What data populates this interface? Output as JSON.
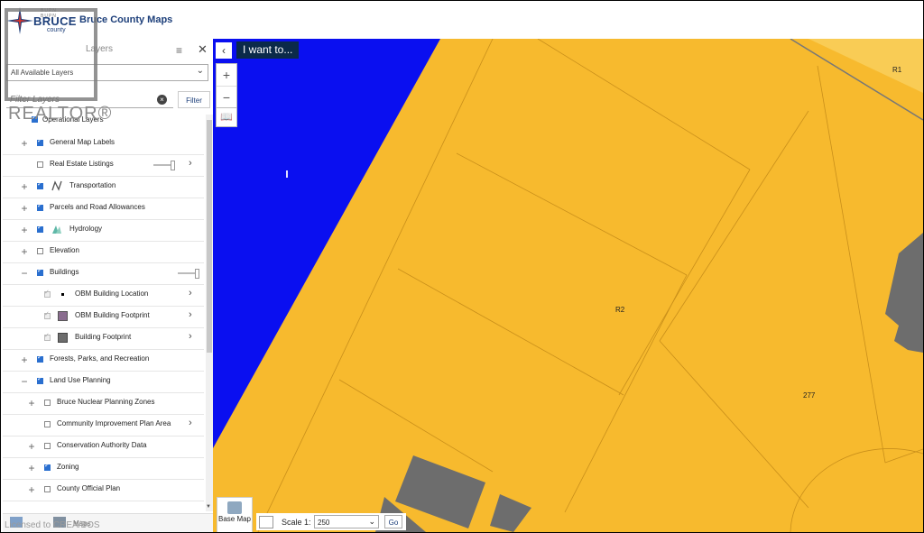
{
  "header": {
    "app_title": "Bruce County Maps",
    "logo_word": "BRUCE",
    "logo_sub": "county",
    "logo_tiny": "BUPN BUPN"
  },
  "panel": {
    "title": "Layers",
    "select_value": "All Available Layers",
    "filter_placeholder": "Filter Layers",
    "filter_button": "Filter",
    "root_label": "Operational Layers",
    "layers": [
      {
        "label": "General Map Labels",
        "checked": true,
        "expand": true
      },
      {
        "label": "Real Estate Listings",
        "checked": false
      },
      {
        "label": "Transportation",
        "checked": true,
        "expand": true
      },
      {
        "label": "Parcels and Road Allowances",
        "checked": true,
        "expand": true
      },
      {
        "label": "Hydrology",
        "checked": true,
        "expand": true
      },
      {
        "label": "Elevation",
        "checked": false,
        "expand": true
      },
      {
        "label": "Buildings",
        "checked": true,
        "expanded": true
      },
      {
        "label": "OBM Building Location",
        "checked": true
      },
      {
        "label": "OBM Building Footprint",
        "checked": true
      },
      {
        "label": "Building Footprint",
        "checked": true
      },
      {
        "label": "Forests, Parks, and Recreation",
        "checked": true,
        "expand": true
      },
      {
        "label": "Land Use Planning",
        "checked": true,
        "expanded": true
      },
      {
        "label": "Bruce Nuclear Planning Zones",
        "checked": false,
        "expand": true
      },
      {
        "label": "Community Improvement Plan Area",
        "checked": false
      },
      {
        "label": "Conservation Authority Data",
        "checked": false,
        "expand": true
      },
      {
        "label": "Zoning",
        "checked": true,
        "expand": true
      },
      {
        "label": "County Official Plan",
        "checked": false,
        "expand": true
      }
    ],
    "bottom_tab_label": "Maps"
  },
  "map": {
    "i_want_to": "I want to...",
    "labels": {
      "r1": "R1",
      "r2": "R2",
      "parcel_277": "277"
    },
    "base_map_label": "Base Map",
    "scale_label": "Scale 1:",
    "scale_value": "250",
    "go_label": "Go",
    "colors": {
      "zoning": "#f7ba2e",
      "water": "#0a0ff0",
      "building": "#6d6d6d"
    }
  },
  "watermark": {
    "realtor": "REALTOR®",
    "credit": "Licensed to CREA/BOS"
  }
}
